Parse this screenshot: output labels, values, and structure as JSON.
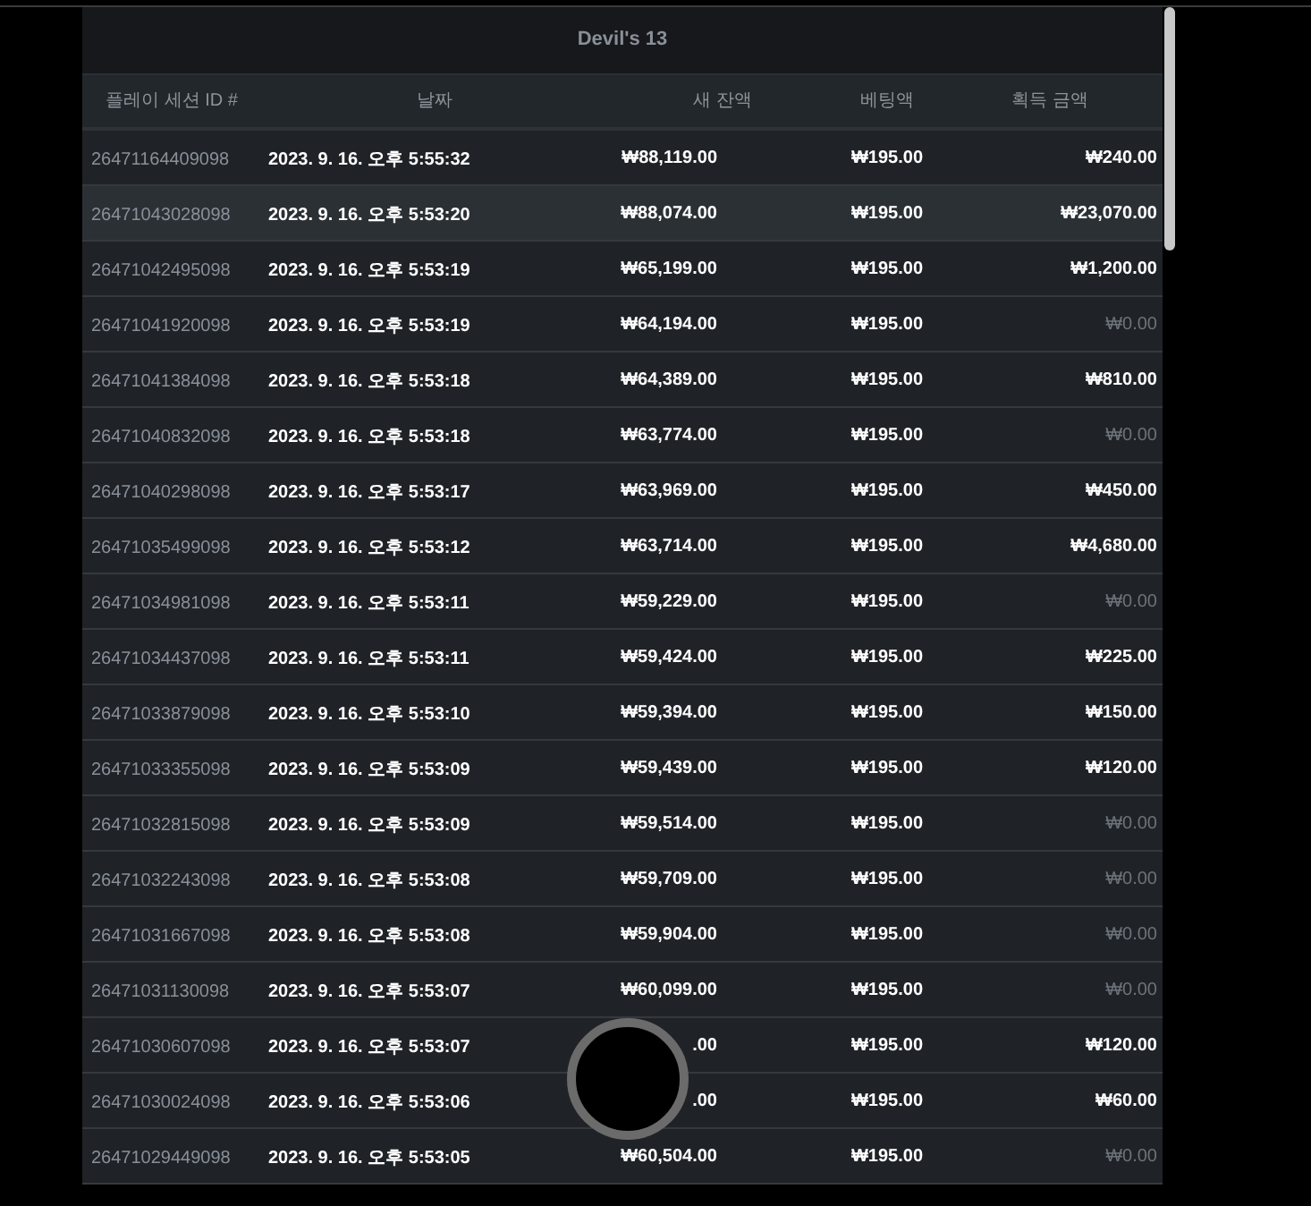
{
  "title": "Devil's 13",
  "columns": [
    "플레이 세션 ID #",
    "날짜",
    "새 잔액",
    "베팅액",
    "획득 금액"
  ],
  "rows": [
    {
      "id": "26471164409098",
      "date": "2023. 9. 16. 오후 5:55:32",
      "balance": "₩88,119.00",
      "bet": "₩195.00",
      "win": "₩240.00",
      "win_muted": false,
      "highlighted": false
    },
    {
      "id": "26471043028098",
      "date": "2023. 9. 16. 오후 5:53:20",
      "balance": "₩88,074.00",
      "bet": "₩195.00",
      "win": "₩23,070.00",
      "win_muted": false,
      "highlighted": true
    },
    {
      "id": "26471042495098",
      "date": "2023. 9. 16. 오후 5:53:19",
      "balance": "₩65,199.00",
      "bet": "₩195.00",
      "win": "₩1,200.00",
      "win_muted": false,
      "highlighted": false
    },
    {
      "id": "26471041920098",
      "date": "2023. 9. 16. 오후 5:53:19",
      "balance": "₩64,194.00",
      "bet": "₩195.00",
      "win": "₩0.00",
      "win_muted": true,
      "highlighted": false
    },
    {
      "id": "26471041384098",
      "date": "2023. 9. 16. 오후 5:53:18",
      "balance": "₩64,389.00",
      "bet": "₩195.00",
      "win": "₩810.00",
      "win_muted": false,
      "highlighted": false
    },
    {
      "id": "26471040832098",
      "date": "2023. 9. 16. 오후 5:53:18",
      "balance": "₩63,774.00",
      "bet": "₩195.00",
      "win": "₩0.00",
      "win_muted": true,
      "highlighted": false
    },
    {
      "id": "26471040298098",
      "date": "2023. 9. 16. 오후 5:53:17",
      "balance": "₩63,969.00",
      "bet": "₩195.00",
      "win": "₩450.00",
      "win_muted": false,
      "highlighted": false
    },
    {
      "id": "26471035499098",
      "date": "2023. 9. 16. 오후 5:53:12",
      "balance": "₩63,714.00",
      "bet": "₩195.00",
      "win": "₩4,680.00",
      "win_muted": false,
      "highlighted": false
    },
    {
      "id": "26471034981098",
      "date": "2023. 9. 16. 오후 5:53:11",
      "balance": "₩59,229.00",
      "bet": "₩195.00",
      "win": "₩0.00",
      "win_muted": true,
      "highlighted": false
    },
    {
      "id": "26471034437098",
      "date": "2023. 9. 16. 오후 5:53:11",
      "balance": "₩59,424.00",
      "bet": "₩195.00",
      "win": "₩225.00",
      "win_muted": false,
      "highlighted": false
    },
    {
      "id": "26471033879098",
      "date": "2023. 9. 16. 오후 5:53:10",
      "balance": "₩59,394.00",
      "bet": "₩195.00",
      "win": "₩150.00",
      "win_muted": false,
      "highlighted": false
    },
    {
      "id": "26471033355098",
      "date": "2023. 9. 16. 오후 5:53:09",
      "balance": "₩59,439.00",
      "bet": "₩195.00",
      "win": "₩120.00",
      "win_muted": false,
      "highlighted": false
    },
    {
      "id": "26471032815098",
      "date": "2023. 9. 16. 오후 5:53:09",
      "balance": "₩59,514.00",
      "bet": "₩195.00",
      "win": "₩0.00",
      "win_muted": true,
      "highlighted": false
    },
    {
      "id": "26471032243098",
      "date": "2023. 9. 16. 오후 5:53:08",
      "balance": "₩59,709.00",
      "bet": "₩195.00",
      "win": "₩0.00",
      "win_muted": true,
      "highlighted": false
    },
    {
      "id": "26471031667098",
      "date": "2023. 9. 16. 오후 5:53:08",
      "balance": "₩59,904.00",
      "bet": "₩195.00",
      "win": "₩0.00",
      "win_muted": true,
      "highlighted": false
    },
    {
      "id": "26471031130098",
      "date": "2023. 9. 16. 오후 5:53:07",
      "balance": "₩60,099.00",
      "bet": "₩195.00",
      "win": "₩0.00",
      "win_muted": true,
      "highlighted": false
    },
    {
      "id": "26471030607098",
      "date": "2023. 9. 16. 오후 5:53:07",
      "balance": ".00",
      "bet": "₩195.00",
      "win": "₩120.00",
      "win_muted": false,
      "highlighted": false
    },
    {
      "id": "26471030024098",
      "date": "2023. 9. 16. 오후 5:53:06",
      "balance": ".00",
      "bet": "₩195.00",
      "win": "₩60.00",
      "win_muted": false,
      "highlighted": false
    },
    {
      "id": "26471029449098",
      "date": "2023. 9. 16. 오후 5:53:05",
      "balance": "₩60,504.00",
      "bet": "₩195.00",
      "win": "₩0.00",
      "win_muted": true,
      "highlighted": false
    }
  ]
}
